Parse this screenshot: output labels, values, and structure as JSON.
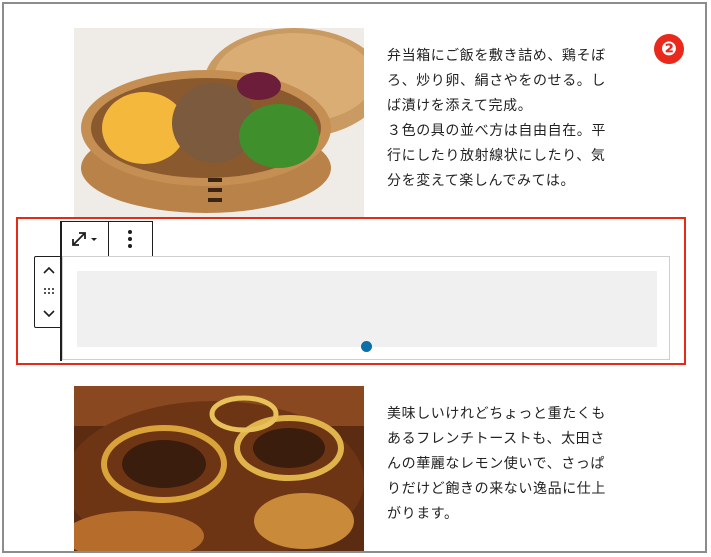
{
  "step_badge": "❷",
  "photos": {
    "top": {
      "icon": "bento-photo"
    },
    "bottom": {
      "icon": "lemon-french-toast-photo"
    }
  },
  "paragraphs": {
    "top": "弁当箱にご飯を敷き詰め、鶏そぼ\nろ、炒り卵、絹さやをのせる。し\nば漬けを添えて完成。\n３色の具の並べ方は自由自在。平\n行にしたり放射線状にしたり、気\n分を変えて楽しんでみては。",
    "bottom": "美味しいけれどちょっと重たくも\nあるフレンチトーストも、太田さ\nんの華麗なレモン使いで、さっぱ\nりだけど飽きの来ない逸品に仕上\nがります。"
  },
  "editor": {
    "mover": {
      "up_icon": "chevron-up-icon",
      "drag_icon": "drag-handle-icon",
      "down_icon": "chevron-down-icon"
    },
    "toolbar": {
      "resize_icon": "resize-icon",
      "more_icon": "more-vertical-icon"
    },
    "colors": {
      "highlight": "#e52a15",
      "handle": "#0a6ea8",
      "spacer": "#f0f0f1"
    }
  }
}
